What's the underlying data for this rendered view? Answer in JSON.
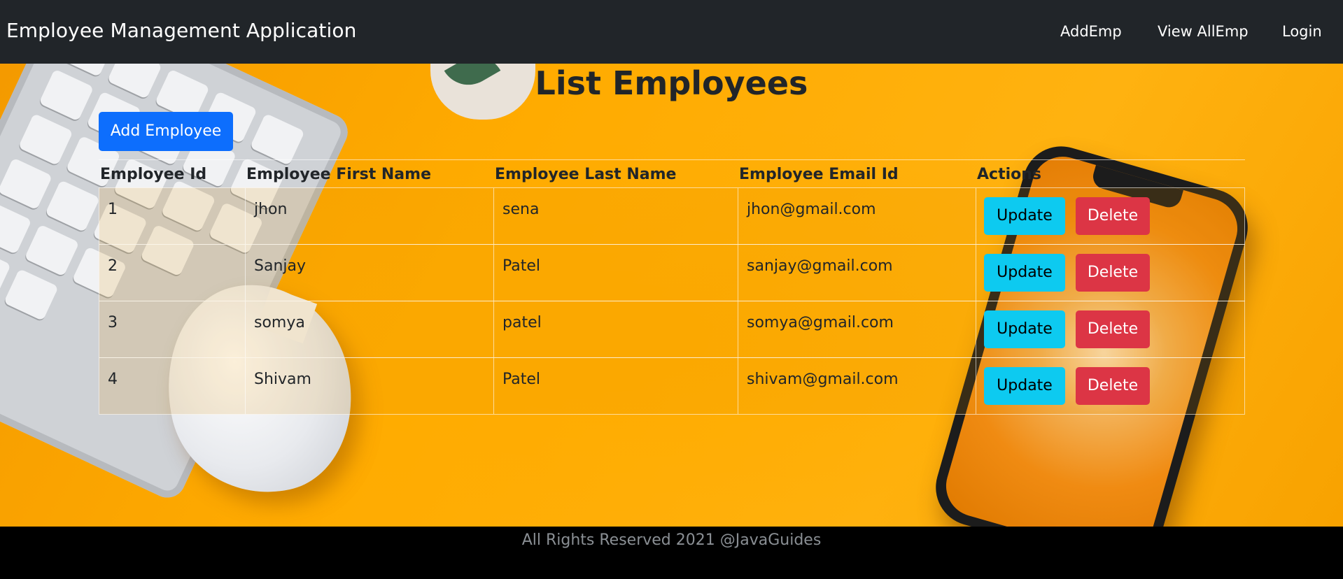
{
  "navbar": {
    "brand": "Employee Management Application",
    "links": [
      "AddEmp",
      "View AllEmp",
      "Login"
    ]
  },
  "main": {
    "title": "List Employees",
    "add_button": "Add Employee"
  },
  "table": {
    "headers": [
      "Employee Id",
      "Employee First Name",
      "Employee Last Name",
      "Employee Email Id",
      "Actions"
    ],
    "rows": [
      {
        "id": "1",
        "first": "jhon",
        "last": "sena",
        "email": "jhon@gmail.com"
      },
      {
        "id": "2",
        "first": "Sanjay",
        "last": "Patel",
        "email": "sanjay@gmail.com"
      },
      {
        "id": "3",
        "first": "somya",
        "last": "patel",
        "email": "somya@gmail.com"
      },
      {
        "id": "4",
        "first": "Shivam",
        "last": "Patel",
        "email": "shivam@gmail.com"
      }
    ],
    "update_label": "Update",
    "delete_label": "Delete"
  },
  "footer": {
    "text": "All Rights Reserved 2021 @JavaGuides"
  },
  "colors": {
    "navbar_bg": "#212529",
    "primary": "#0d6efd",
    "info": "#0dcaf0",
    "danger": "#dc3545",
    "background_accent": "#ffab00"
  }
}
